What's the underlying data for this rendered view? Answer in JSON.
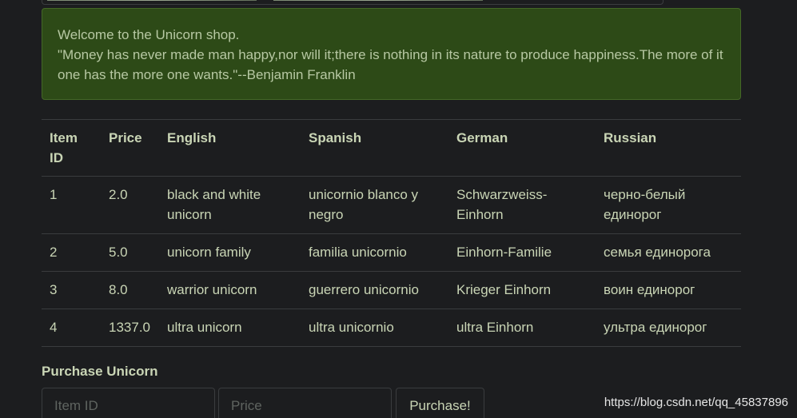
{
  "alert": {
    "line1": "Welcome to the Unicorn shop.",
    "line2": "\"Money has never made man happy,nor will it;there is nothing in its nature to produce happiness.The more of it one has the more one wants.\"--Benjamin Franklin"
  },
  "table": {
    "headers": [
      "Item ID",
      "Price",
      "English",
      "Spanish",
      "German",
      "Russian"
    ],
    "rows": [
      [
        "1",
        "2.0",
        "black and white unicorn",
        "unicornio blanco y negro",
        "Schwarzweiss-Einhorn",
        "черно-белый единорог"
      ],
      [
        "2",
        "5.0",
        "unicorn family",
        "familia unicornio",
        "Einhorn-Familie",
        "семья единорога"
      ],
      [
        "3",
        "8.0",
        "warrior unicorn",
        "guerrero unicornio",
        "Krieger Einhorn",
        "воин единорог"
      ],
      [
        "4",
        "1337.0",
        "ultra unicorn",
        "ultra unicornio",
        "ultra Einhorn",
        "ультра единорог"
      ]
    ]
  },
  "purchase": {
    "title": "Purchase Unicorn",
    "item_id_placeholder": "Item ID",
    "price_placeholder": "Price",
    "button_label": "Purchase!"
  },
  "watermark": "https://blog.csdn.net/qq_45837896"
}
